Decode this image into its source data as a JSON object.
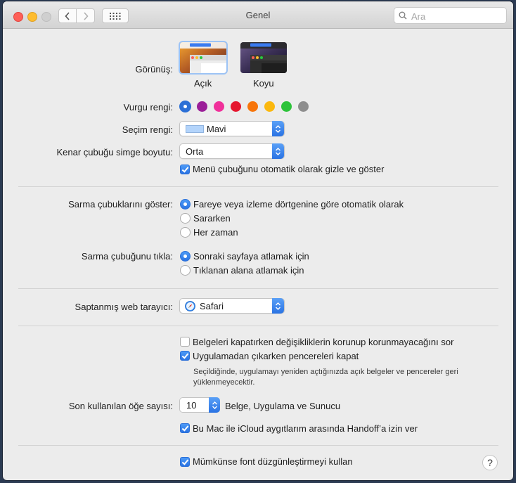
{
  "window": {
    "title": "Genel"
  },
  "search": {
    "placeholder": "Ara"
  },
  "appearance": {
    "label": "Görünüş:",
    "options": [
      {
        "label": "Açık",
        "selected": true
      },
      {
        "label": "Koyu",
        "selected": false
      }
    ]
  },
  "accent": {
    "label": "Vurgu rengi:",
    "colors": [
      "#2b6fd6",
      "#9b1f98",
      "#f0309a",
      "#e5172f",
      "#f7750a",
      "#fbb80f",
      "#2dc33a",
      "#8e8e8e"
    ],
    "selected_index": 0
  },
  "highlight": {
    "label": "Seçim rengi:",
    "value": "Mavi",
    "swatch": "#b3d4fb"
  },
  "sidebar_icon": {
    "label": "Kenar çubuğu simge boyutu:",
    "value": "Orta"
  },
  "menubar_autohide": {
    "label": "Menü çubuğunu otomatik olarak gizle ve göster",
    "checked": true
  },
  "show_scrollbars": {
    "label": "Sarma çubuklarını göster:",
    "options": [
      {
        "label": "Fareye veya izleme dörtgenine göre otomatik olarak",
        "selected": true
      },
      {
        "label": "Sararken",
        "selected": false
      },
      {
        "label": "Her zaman",
        "selected": false
      }
    ]
  },
  "click_scrollbar": {
    "label": "Sarma çubuğunu tıkla:",
    "options": [
      {
        "label": "Sonraki sayfaya atlamak için",
        "selected": true
      },
      {
        "label": "Tıklanan alana atlamak için",
        "selected": false
      }
    ]
  },
  "default_browser": {
    "label": "Saptanmış web tarayıcı:",
    "value": "Safari"
  },
  "ask_keep_changes": {
    "label": "Belgeleri kapatırken değişikliklerin korunup korunmayacağını sor",
    "checked": false
  },
  "close_windows": {
    "label": "Uygulamadan çıkarken pencereleri kapat",
    "checked": true
  },
  "close_windows_note": {
    "line1": "Seçildiğinde, uygulamayı yeniden açtığınızda açık belgeler ve pencereler geri",
    "line2": "yüklenmeyecektir."
  },
  "recent_items": {
    "label": "Son kullanılan öğe sayısı:",
    "value": "10",
    "suffix": "Belge, Uygulama ve Sunucu"
  },
  "handoff": {
    "label": "Bu Mac ile iCloud aygıtlarım arasında Handoff’a izin ver",
    "checked": true
  },
  "font_smoothing": {
    "label": "Mümkünse font düzgünleştirmeyi kullan",
    "checked": true
  },
  "help": {
    "label": "?"
  }
}
